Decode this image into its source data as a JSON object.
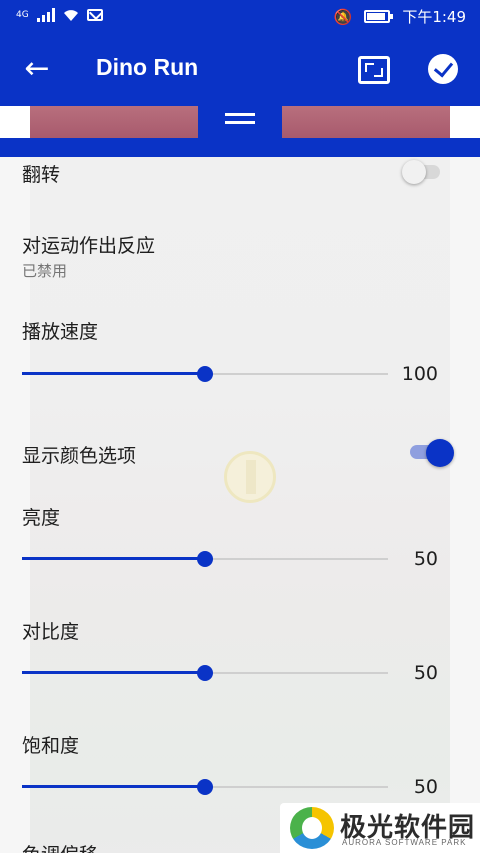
{
  "status_bar": {
    "network": "4G",
    "time": "下午1:49"
  },
  "app_bar": {
    "title": "Dino Run",
    "icons": [
      "back-arrow-icon",
      "fullscreen-icon",
      "check-icon"
    ]
  },
  "settings": {
    "flip": {
      "label": "翻转",
      "enabled": false
    },
    "motion": {
      "label": "对运动作出反应",
      "status": "已禁用"
    },
    "speed": {
      "label": "播放速度",
      "value": "100",
      "fraction": 0.5
    },
    "color_options": {
      "label": "显示颜色选项",
      "enabled": true
    },
    "brightness": {
      "label": "亮度",
      "value": "50",
      "fraction": 0.5
    },
    "contrast": {
      "label": "对比度",
      "value": "50",
      "fraction": 0.5
    },
    "saturation": {
      "label": "饱和度",
      "value": "50",
      "fraction": 0.5
    },
    "hue": {
      "label": "色调偏移"
    }
  },
  "colors": {
    "accent": "#0a33c6",
    "toggle_off_track": "#d8d8d8",
    "toggle_off_thumb": "#f1f1f1",
    "toggle_on_track": "#8f9fdf"
  },
  "watermark": {
    "cn": "极光软件园",
    "en": "AURORA SOFTWARE PARK"
  }
}
